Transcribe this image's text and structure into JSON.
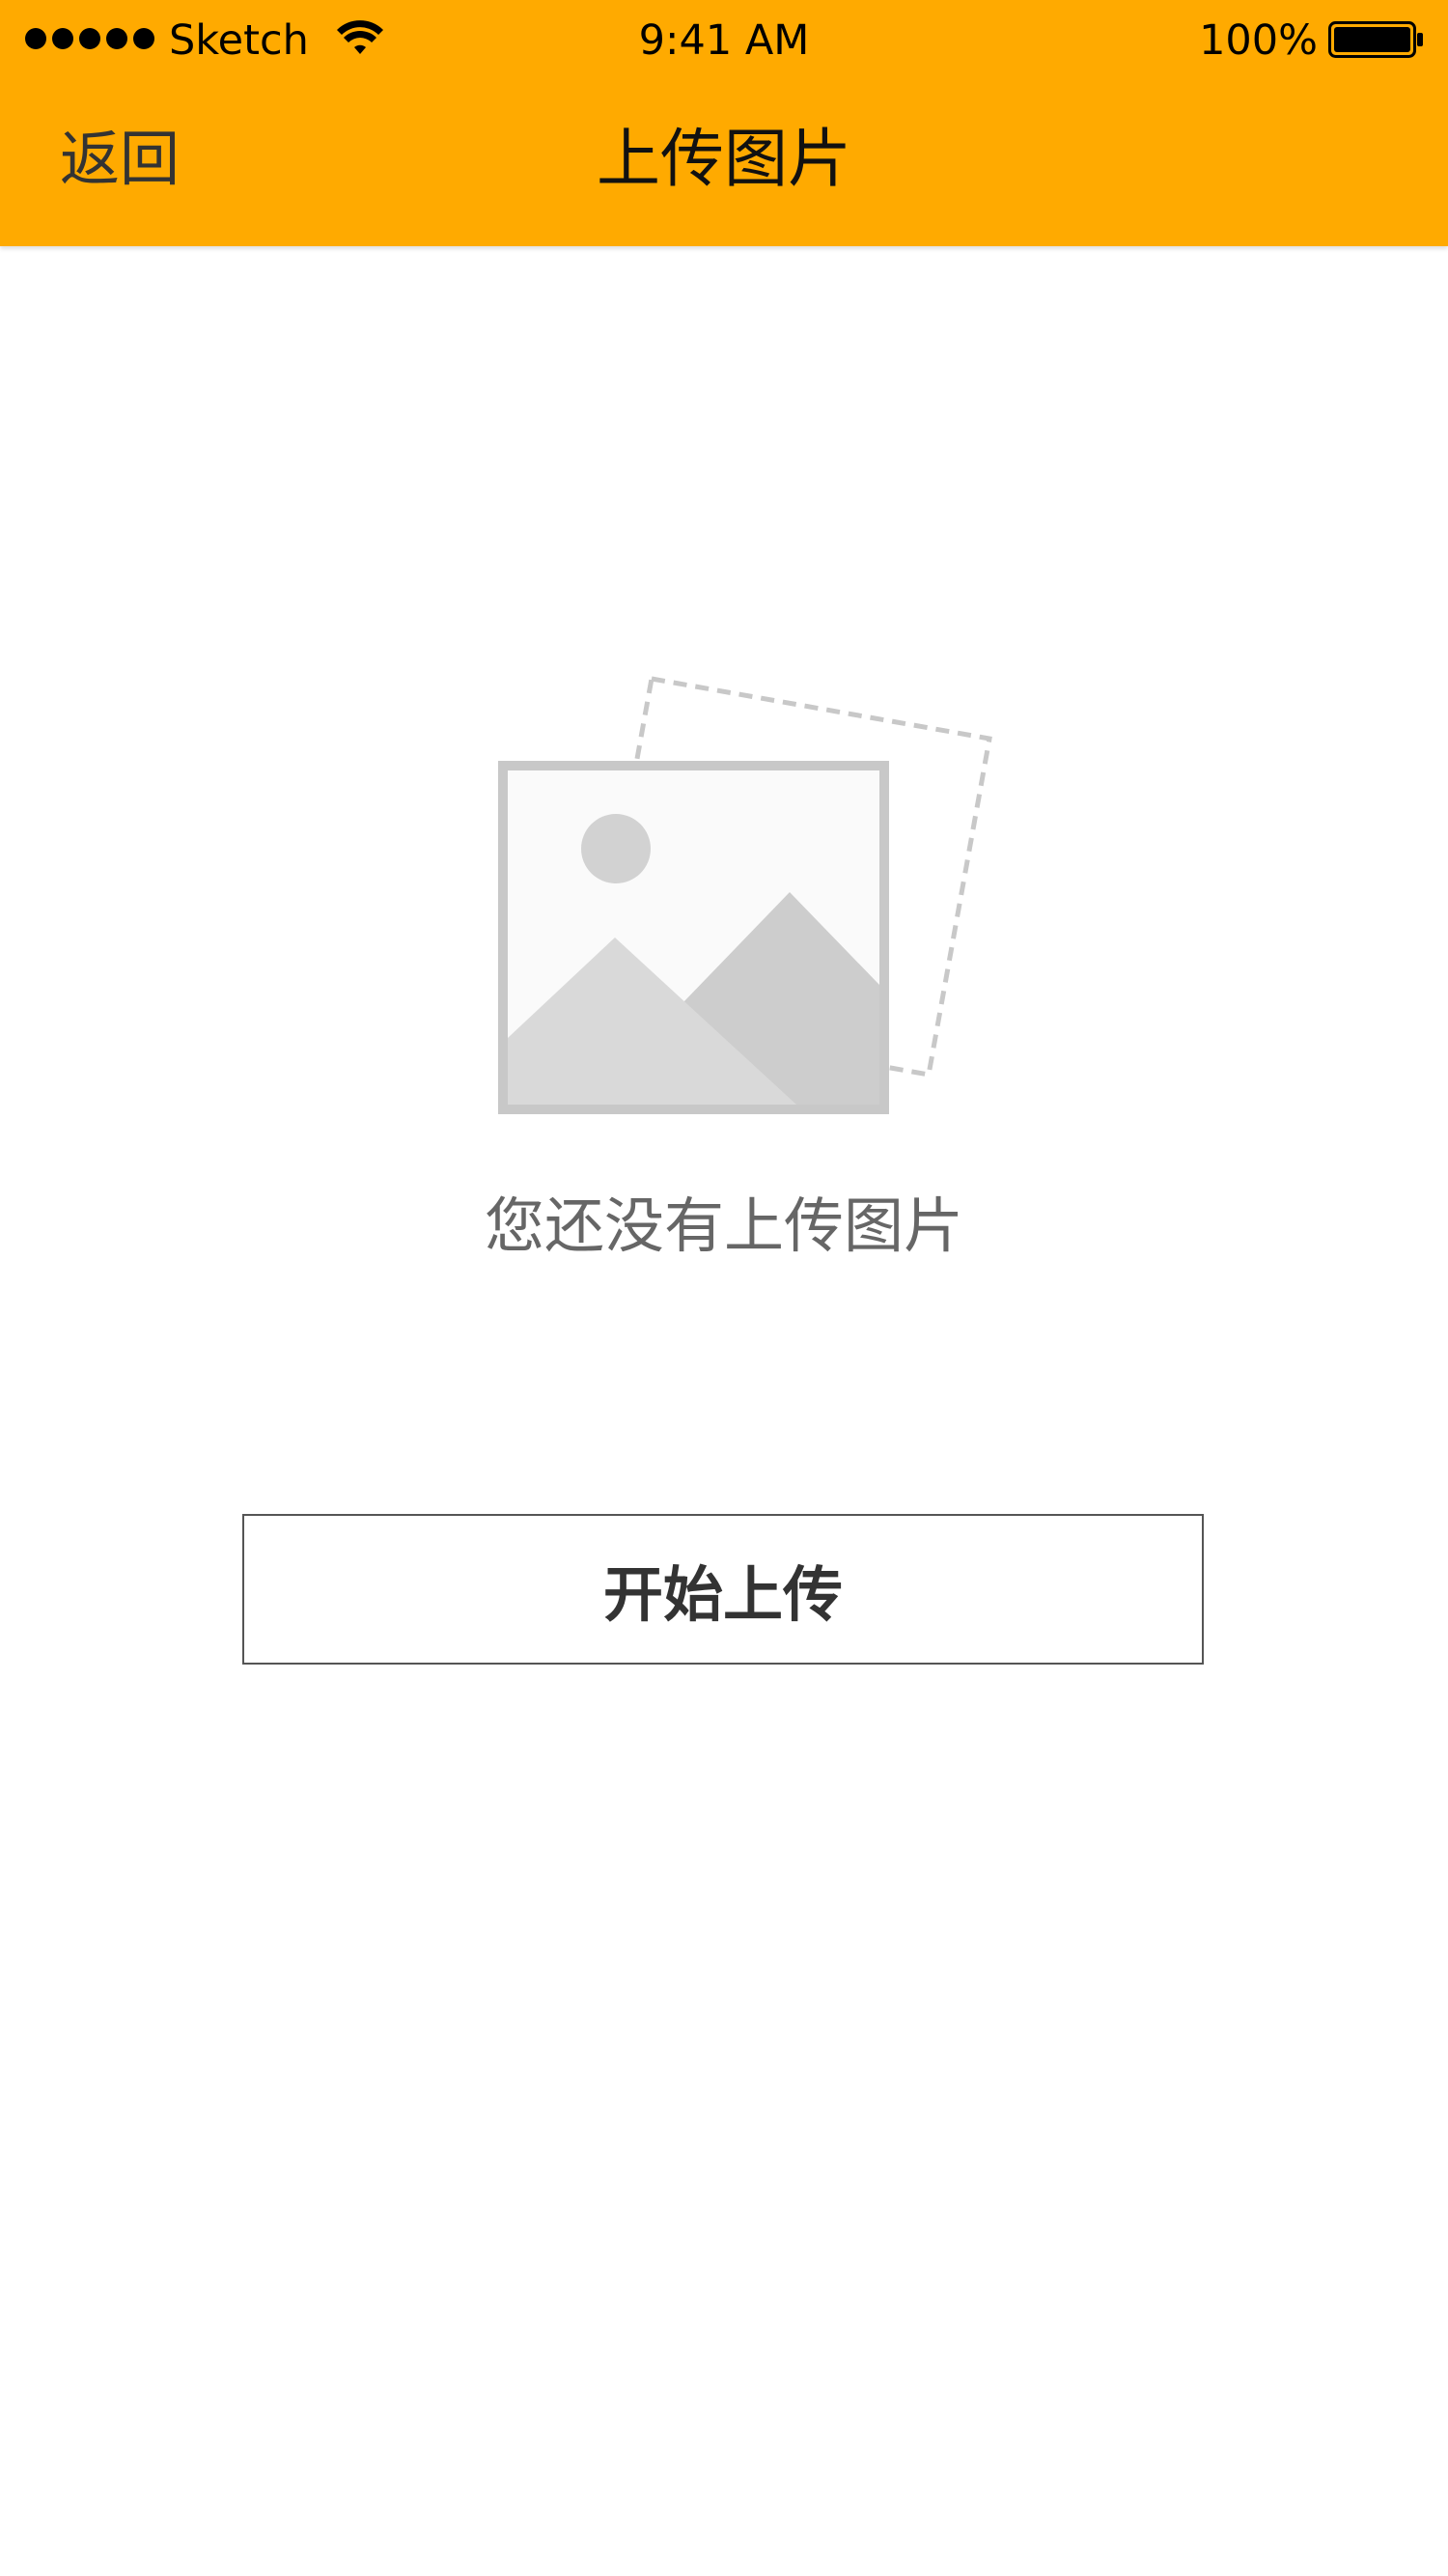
{
  "status_bar": {
    "carrier": "Sketch",
    "time": "9:41 AM",
    "battery_percent": "100%",
    "signal_dots": 5,
    "icons": [
      "signal-dots-icon",
      "wifi-icon",
      "battery-icon"
    ]
  },
  "nav": {
    "back_label": "返回",
    "title": "上传图片"
  },
  "empty_state": {
    "icon": "image-placeholder-icon",
    "message": "您还没有上传图片"
  },
  "actions": {
    "upload_label": "开始上传"
  },
  "colors": {
    "header_background": "#FFAA00",
    "page_background": "#FFFFFF",
    "placeholder_gray": "#C8C8C8",
    "message_text": "#666666",
    "button_border": "#555555"
  }
}
